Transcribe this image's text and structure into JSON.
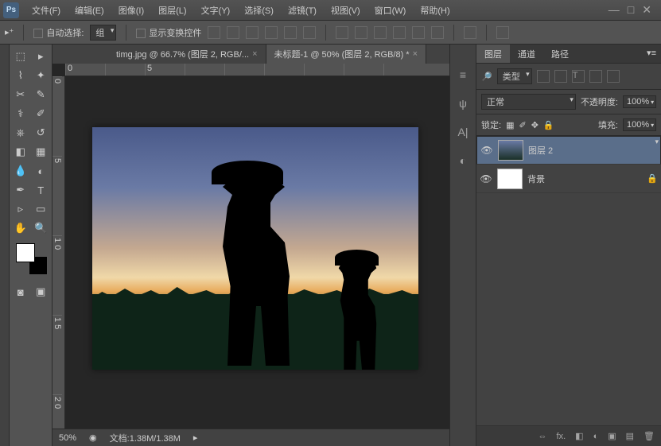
{
  "app": {
    "logo": "Ps"
  },
  "menu": [
    "文件(F)",
    "编辑(E)",
    "图像(I)",
    "图层(L)",
    "文字(Y)",
    "选择(S)",
    "滤镜(T)",
    "视图(V)",
    "窗口(W)",
    "帮助(H)"
  ],
  "optbar": {
    "auto_select": "自动选择:",
    "group": "组",
    "show_transform": "显示变换控件"
  },
  "tabs": [
    {
      "label": "timg.jpg @ 66.7% (图层 2, RGB/..."
    },
    {
      "label": "未标题-1 @ 50% (图层 2, RGB/8) *"
    }
  ],
  "panel": {
    "tabs": [
      "图层",
      "通道",
      "路径"
    ],
    "kind": "类型",
    "blend": "正常",
    "opacity_label": "不透明度:",
    "opacity": "100%",
    "lock_label": "锁定:",
    "fill_label": "填充:",
    "fill": "100%"
  },
  "layers": [
    {
      "name": "图层 2",
      "locked": false
    },
    {
      "name": "背景",
      "locked": true
    }
  ],
  "status": {
    "zoom": "50%",
    "doc": "文档:1.38M/1.38M"
  },
  "ruler_h": [
    "0",
    "",
    "5"
  ],
  "ruler_v": [
    "0",
    "",
    "5",
    "",
    "1 0",
    "",
    "1 5",
    "",
    "2 0"
  ]
}
